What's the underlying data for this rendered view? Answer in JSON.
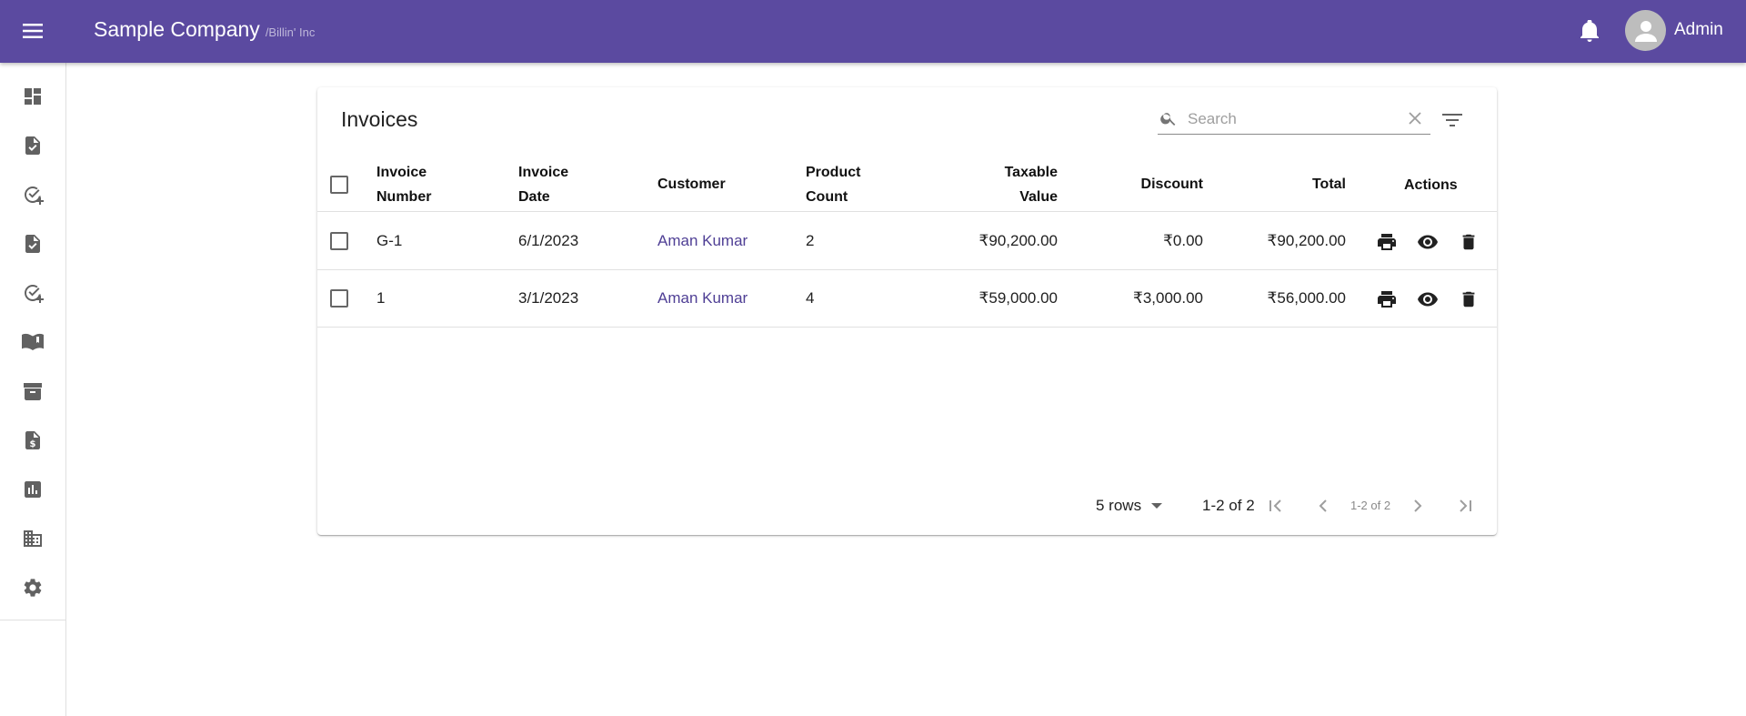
{
  "app": {
    "title": "Sample Company",
    "subtitle": "/Billin' Inc",
    "user_name": "Admin",
    "bar_color": "#5b4aa0"
  },
  "sidenav": {
    "icons": [
      "dashboard-icon",
      "invoice-check-icon",
      "add-check-icon",
      "invoice-check-icon-2",
      "add-check-icon-2",
      "book-icon",
      "archive-icon",
      "dollar-document-icon",
      "chart-icon",
      "business-icon",
      "settings-icon"
    ]
  },
  "invoices": {
    "title": "Invoices",
    "search_placeholder": "Search",
    "columns": {
      "invoice_number_1": "Invoice",
      "invoice_number_2": "Number",
      "invoice_date_1": "Invoice",
      "invoice_date_2": "Date",
      "customer": "Customer",
      "product_count_1": "Product",
      "product_count_2": "Count",
      "taxable_value_1": "Taxable",
      "taxable_value_2": "Value",
      "discount": "Discount",
      "total": "Total",
      "actions": "Actions"
    },
    "rows": [
      {
        "invoice_number": "G-1",
        "invoice_date": "6/1/2023",
        "customer": "Aman Kumar",
        "product_count": "2",
        "taxable_value": "₹90,200.00",
        "discount": "₹0.00",
        "total": "₹90,200.00"
      },
      {
        "invoice_number": "1",
        "invoice_date": "3/1/2023",
        "customer": "Aman Kumar",
        "product_count": "4",
        "taxable_value": "₹59,000.00",
        "discount": "₹3,000.00",
        "total": "₹56,000.00"
      }
    ],
    "pagination": {
      "rows_label": "5 rows",
      "count_label": "1-2 of 2",
      "inline_label": "1-2 of 2"
    },
    "link_color": "#4f3f95"
  }
}
